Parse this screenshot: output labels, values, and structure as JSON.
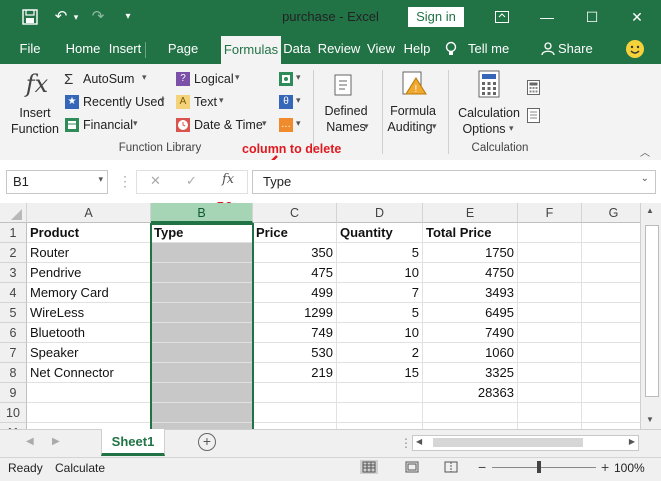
{
  "window": {
    "title": "purchase  -  Excel",
    "signin": "Sign in"
  },
  "tabs": [
    {
      "label": "File"
    },
    {
      "label": "Home"
    },
    {
      "label": "Insert"
    },
    {
      "label": "Page Layout"
    },
    {
      "label": "Formulas"
    },
    {
      "label": "Data"
    },
    {
      "label": "Review"
    },
    {
      "label": "View"
    },
    {
      "label": "Help"
    }
  ],
  "tellme": "Tell me",
  "share": "Share",
  "ribbon": {
    "insert_function_line1": "Insert",
    "insert_function_line2": "Function",
    "autosum": "AutoSum",
    "recently_used": "Recently Used",
    "financial": "Financial",
    "logical": "Logical",
    "text": "Text",
    "datetime": "Date & Time",
    "defined_names_line1": "Defined",
    "defined_names_line2": "Names",
    "formula_auditing_line1": "Formula",
    "formula_auditing_line2": "Auditing",
    "calc_options_line1": "Calculation",
    "calc_options_line2": "Options",
    "group_function_library": "Function Library",
    "group_calculation": "Calculation"
  },
  "formula_bar": {
    "name_box": "B1",
    "fx": "fx",
    "content": "Type"
  },
  "annotation": "column to delete",
  "columns": [
    "A",
    "B",
    "C",
    "D",
    "E",
    "F",
    "G"
  ],
  "rows": [
    {
      "n": "1",
      "a": "Product",
      "b": "Type",
      "c": "Price",
      "d": "Quantity",
      "e": "Total Price"
    },
    {
      "n": "2",
      "a": "Router",
      "b": "",
      "c": "350",
      "d": "5",
      "e": "1750"
    },
    {
      "n": "3",
      "a": "Pendrive",
      "b": "",
      "c": "475",
      "d": "10",
      "e": "4750"
    },
    {
      "n": "4",
      "a": "Memory Card",
      "b": "",
      "c": "499",
      "d": "7",
      "e": "3493"
    },
    {
      "n": "5",
      "a": "WireLess",
      "b": "",
      "c": "1299",
      "d": "5",
      "e": "6495"
    },
    {
      "n": "6",
      "a": "Bluetooth",
      "b": "",
      "c": "749",
      "d": "10",
      "e": "7490"
    },
    {
      "n": "7",
      "a": "Speaker",
      "b": "",
      "c": "530",
      "d": "2",
      "e": "1060"
    },
    {
      "n": "8",
      "a": "Net Connector",
      "b": "",
      "c": "219",
      "d": "15",
      "e": "3325"
    },
    {
      "n": "9",
      "a": "",
      "b": "",
      "c": "",
      "d": "",
      "e": "28363"
    },
    {
      "n": "10",
      "a": "",
      "b": "",
      "c": "",
      "d": "",
      "e": ""
    },
    {
      "n": "11",
      "a": "",
      "b": "",
      "c": "",
      "d": "",
      "e": ""
    }
  ],
  "sheet_tab": "Sheet1",
  "status": {
    "ready": "Ready",
    "calculate": "Calculate",
    "zoom": "100%"
  },
  "colors": {
    "excel_green": "#217346",
    "annotation_red": "#e0191f",
    "selection_green": "#217346",
    "shaded_cells": "#c8c8c8"
  }
}
